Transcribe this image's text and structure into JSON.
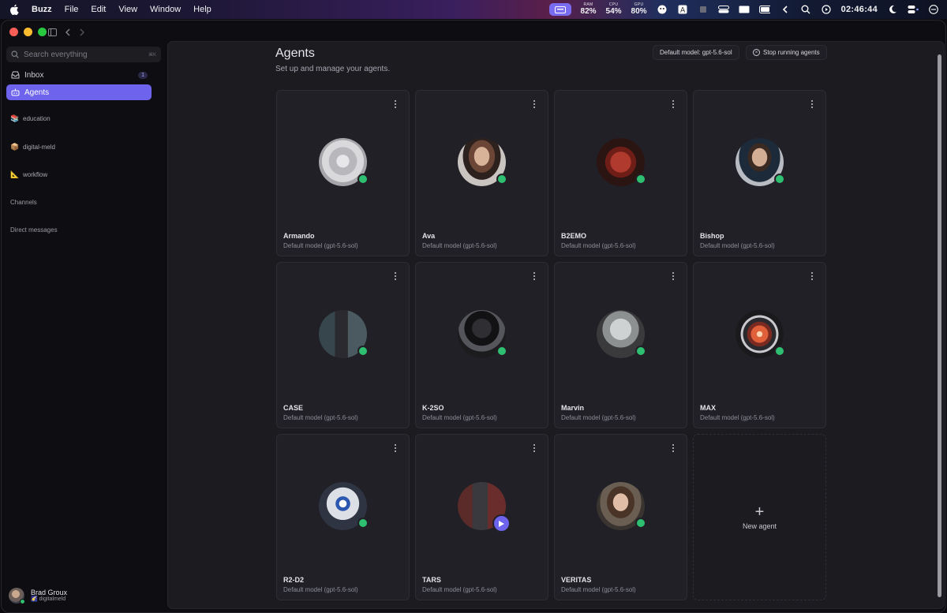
{
  "menubar": {
    "app_name": "Buzz",
    "menus": [
      "File",
      "Edit",
      "View",
      "Window",
      "Help"
    ],
    "ram_label": "RAM",
    "ram_value": "82%",
    "cpu_label": "CPU",
    "cpu_value": "54%",
    "gpu_label": "GPU",
    "gpu_value": "80%",
    "clock": "02:46:44"
  },
  "sidebar": {
    "search_placeholder": "Search everything",
    "search_shortcut": "⌘K",
    "nav": [
      {
        "label": "Inbox",
        "badge": "1"
      },
      {
        "label": "Agents"
      }
    ],
    "workspaces": [
      {
        "emoji": "📚",
        "label": "education"
      },
      {
        "emoji": "📦",
        "label": "digital-meld"
      },
      {
        "emoji": "📐",
        "label": "workflow"
      }
    ],
    "channels_label": "Channels",
    "dm_label": "Direct messages",
    "user": {
      "name": "Brad Groux",
      "handle": "digitalmeld",
      "handle_emoji": "🌠"
    }
  },
  "page": {
    "title": "Agents",
    "subtitle": "Set up and manage your agents.",
    "default_model_button": "Default model: gpt-5.6-sol",
    "stop_button": "Stop running agents"
  },
  "agents": [
    {
      "name": "Armando",
      "model": "Default model (gpt-5.6-sol)"
    },
    {
      "name": "Ava",
      "model": "Default model (gpt-5.6-sol)"
    },
    {
      "name": "B2EMO",
      "model": "Default model (gpt-5.6-sol)"
    },
    {
      "name": "Bishop",
      "model": "Default model (gpt-5.6-sol)"
    },
    {
      "name": "CASE",
      "model": "Default model (gpt-5.6-sol)"
    },
    {
      "name": "K-2SO",
      "model": "Default model (gpt-5.6-sol)"
    },
    {
      "name": "Marvin",
      "model": "Default model (gpt-5.6-sol)"
    },
    {
      "name": "MAX",
      "model": "Default model (gpt-5.6-sol)"
    },
    {
      "name": "R2-D2",
      "model": "Default model (gpt-5.6-sol)"
    },
    {
      "name": "TARS",
      "model": "Default model (gpt-5.6-sol)"
    },
    {
      "name": "VERITAS",
      "model": "Default model (gpt-5.6-sol)"
    }
  ],
  "new_agent_label": "New agent",
  "colors": {
    "accent": "#6d63ec",
    "online": "#2fbf71",
    "panel": "#1b1b20",
    "card": "#202026"
  }
}
